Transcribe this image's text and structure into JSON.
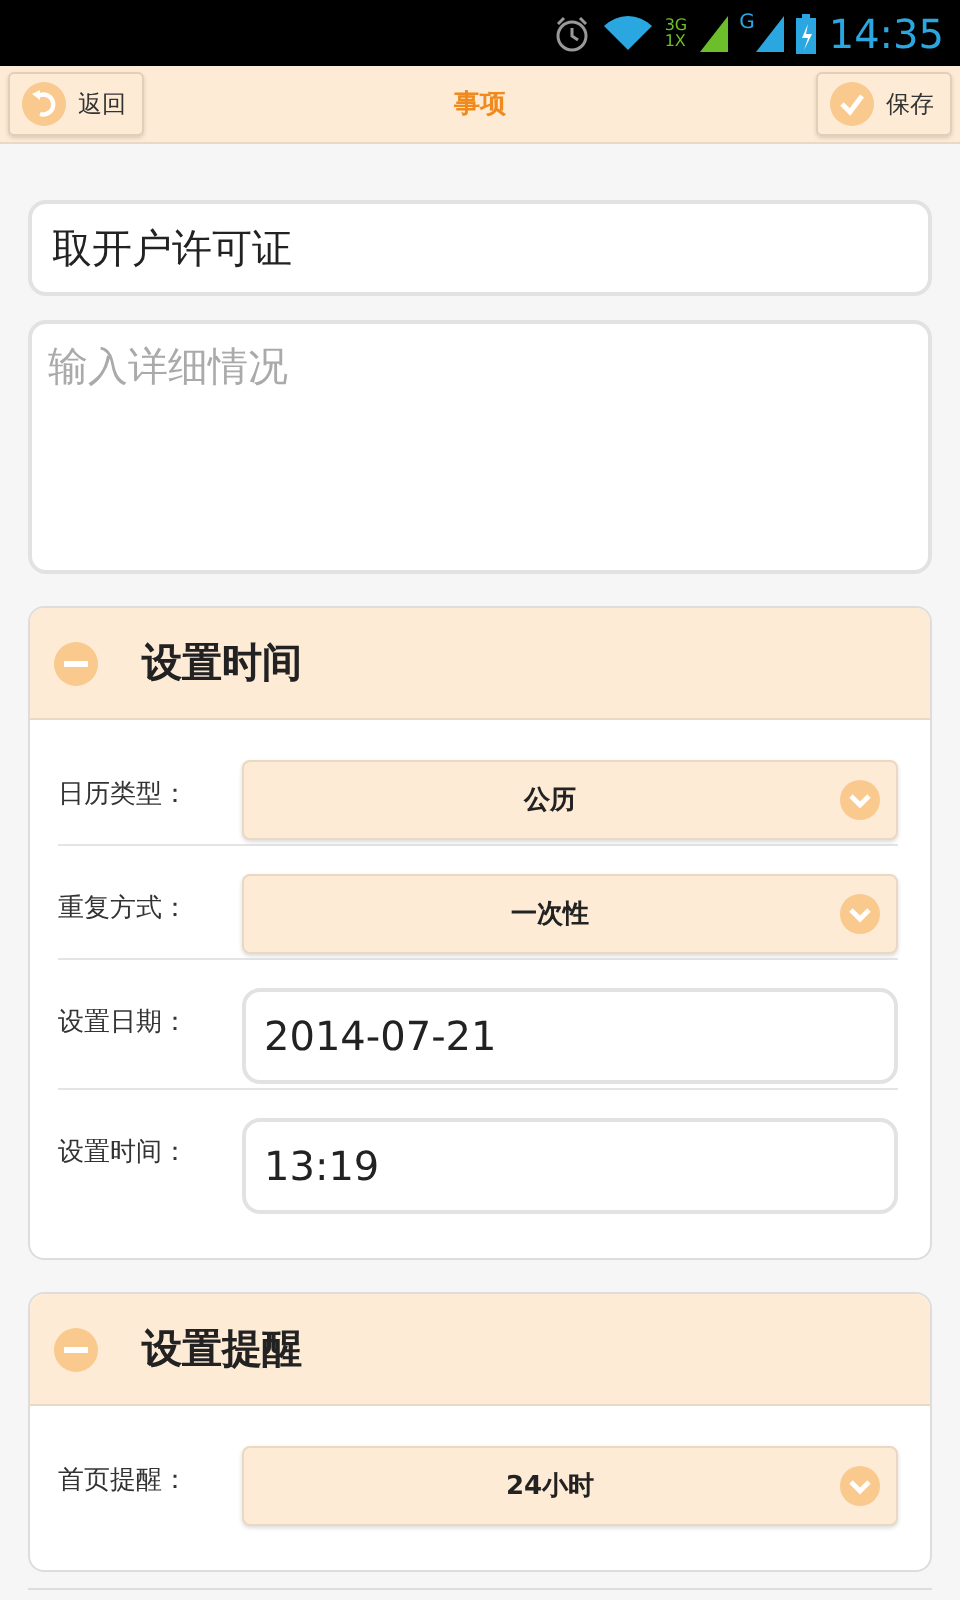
{
  "status_bar": {
    "time": "14:35",
    "network_1": "3G",
    "network_1_sub": "1X",
    "network_2": "G"
  },
  "toolbar": {
    "back": "返回",
    "title": "事项",
    "save": "保存"
  },
  "title_field": {
    "value": "取开户许可证"
  },
  "detail_field": {
    "placeholder": "输入详细情况"
  },
  "sections": [
    {
      "title": "设置时间",
      "expanded": true,
      "rows": [
        {
          "kind": "select",
          "label": "日历类型：",
          "value": "公历"
        },
        {
          "kind": "select",
          "label": "重复方式：",
          "value": "一次性"
        },
        {
          "kind": "input",
          "label": "设置日期：",
          "value": "2014-07-21"
        },
        {
          "kind": "input",
          "label": "设置时间：",
          "value": "13:19"
        }
      ]
    },
    {
      "title": "设置提醒",
      "expanded": true,
      "rows": [
        {
          "kind": "select",
          "label": "首页提醒：",
          "value": "24小时"
        }
      ]
    }
  ]
}
